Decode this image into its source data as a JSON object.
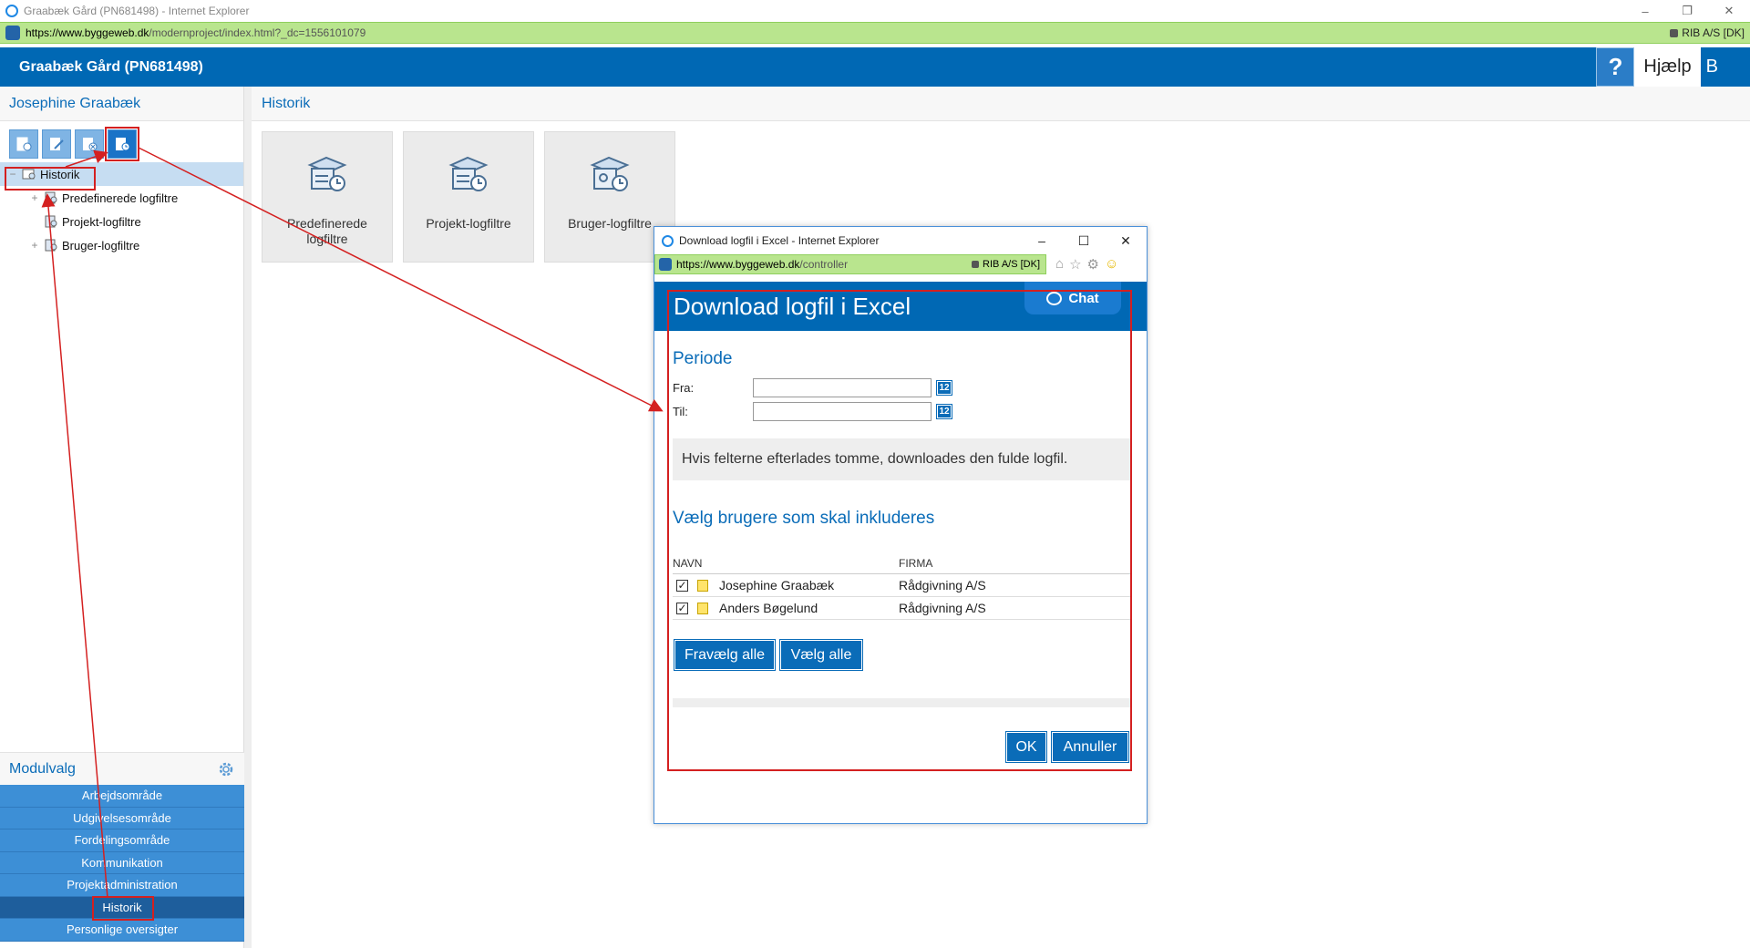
{
  "window": {
    "title": "Graabæk Gård (PN681498) - Internet Explorer",
    "url_host": "https://www.byggeweb.dk",
    "url_rest": "/modernproject/index.html?_dc=1556101079",
    "cert": "RIB A/S [DK]",
    "controls": [
      "–",
      "❐",
      "✕"
    ]
  },
  "header": {
    "project_title": "Graabæk Gård (PN681498)",
    "help_q": "?",
    "help_label": "Hjælp",
    "trailing": "B"
  },
  "sidebar": {
    "user_name": "Josephine Graabæk",
    "toolbar_icons": [
      "gear-doc-icon",
      "pen-doc-icon",
      "cancel-doc-icon",
      "history-doc-icon"
    ],
    "tree": [
      {
        "label": "Historik",
        "expander": "−",
        "selected": true
      },
      {
        "label": "Predefinerede logfiltre",
        "expander": "+"
      },
      {
        "label": "Projekt-logfiltre",
        "expander": ""
      },
      {
        "label": "Bruger-logfiltre",
        "expander": "+"
      }
    ],
    "module_title": "Modulvalg",
    "modules": [
      "Arbejdsområde",
      "Udgivelsesområde",
      "Fordelingsområde",
      "Kommunikation",
      "Projektadministration",
      "Historik",
      "Personlige oversigter"
    ],
    "active_module": "Historik"
  },
  "main": {
    "title": "Historik",
    "tiles": [
      {
        "label": "Predefinerede logfiltre"
      },
      {
        "label": "Projekt-logfiltre"
      },
      {
        "label": "Bruger-logfiltre"
      }
    ]
  },
  "popup": {
    "window_title": "Download logfil i Excel - Internet Explorer",
    "url_host": "https://www.byggeweb.dk",
    "url_rest": "/controller",
    "cert": "RIB A/S [DK]",
    "controls": [
      "–",
      "☐",
      "✕"
    ],
    "dialog_title": "Download logfil i Excel",
    "chat_label": "Chat",
    "period_title": "Periode",
    "from_label": "Fra:",
    "to_label": "Til:",
    "from_value": "",
    "to_value": "",
    "calendar_label": "12",
    "info_text": "Hvis felterne efterlades tomme, downloades den fulde logfil.",
    "users_title": "Vælg brugere som skal inkluderes",
    "col_name": "NAVN",
    "col_company": "FIRMA",
    "users": [
      {
        "name": "Josephine Graabæk",
        "company": "Rådgivning A/S",
        "checked": true
      },
      {
        "name": "Anders Bøgelund",
        "company": "Rådgivning A/S",
        "checked": true
      }
    ],
    "deselect_all": "Fravælg alle",
    "select_all": "Vælg alle",
    "ok": "OK",
    "cancel": "Annuller"
  },
  "colors": {
    "brand_blue": "#0068b4",
    "accent_blue": "#0a6cb8",
    "annotation_red": "#d42020",
    "address_green": "#b9e58e"
  }
}
